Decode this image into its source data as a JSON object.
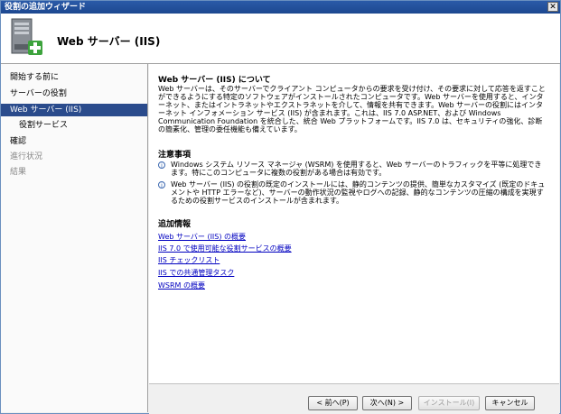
{
  "window": {
    "title": "役割の追加ウィザード",
    "close_label": "✕"
  },
  "header": {
    "title": "Web サーバー (IIS)"
  },
  "nav": {
    "items": [
      {
        "label": "開始する前に",
        "state": "normal"
      },
      {
        "label": "サーバーの役割",
        "state": "normal"
      },
      {
        "label": "Web サーバー (IIS)",
        "state": "active"
      },
      {
        "label": "役割サービス",
        "state": "sub"
      },
      {
        "label": "確認",
        "state": "normal"
      },
      {
        "label": "進行状況",
        "state": "disabled"
      },
      {
        "label": "結果",
        "state": "disabled"
      }
    ]
  },
  "content": {
    "about_title": "Web サーバー (IIS) について",
    "about_text": "Web サーバーは、そのサーバーでクライアント コンピュータからの要求を受け付け、その要求に対して応答を返すことができるようにする特定のソフトウェアがインストールされたコンピュータです。Web サーバーを使用すると、インターネット、またはイントラネットやエクストラネットを介して、情報を共有できます。Web サーバーの役割にはインターネット インフォメーション サービス (IIS) が含まれます。これは、IIS 7.0 ASP.NET、および Windows Communication Foundation を統合した、統合 Web プラットフォームです。IIS 7.0 は、セキュリティの強化、診断の簡素化、管理の委任機能も備えています。",
    "notes_title": "注意事項",
    "notes": [
      "Windows システム リソース マネージャ (WSRM) を使用すると、Web サーバーのトラフィックを平等に処理できます。特にこのコンピュータに複数の役割がある場合は有効です。",
      "Web サーバー (IIS) の役割の既定のインストールには、静的コンテンツの提供、簡単なカスタマイズ (既定のドキュメントや HTTP エラーなど)、サーバーの動作状況の監視やログへの記録、静的なコンテンツの圧縮の構成を実現するための役割サービスのインストールが含まれます。"
    ],
    "more_title": "追加情報",
    "links": [
      "Web サーバー (IIS) の概要",
      "IIS 7.0 で使用可能な役割サービスの概要",
      "IIS チェックリスト",
      "IIS での共通管理タスク",
      "WSRM の概要"
    ]
  },
  "footer": {
    "back_label": "< 前へ(P)",
    "next_label": "次へ(N) >",
    "install_label": "インストール(I)",
    "cancel_label": "キャンセル"
  },
  "colors": {
    "titlebar": "#1d4890",
    "nav_active": "#2a4b8c",
    "link": "#0000c0"
  }
}
